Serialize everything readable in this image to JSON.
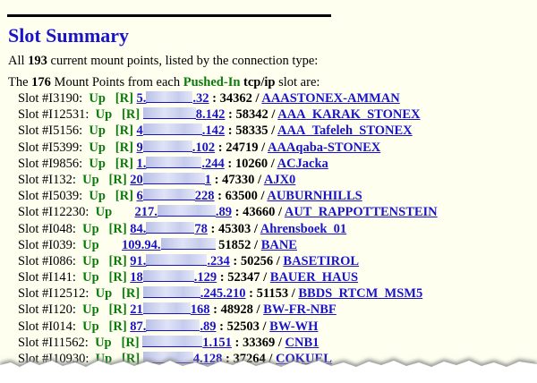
{
  "page": {
    "title": "Slot Summary",
    "intro": {
      "prefix": "All ",
      "count": "193",
      "suffix": " current mount points, listed by the connection type:"
    },
    "section": {
      "prefix": "The ",
      "count": "176",
      "middle": " Mount Points from each ",
      "type": "Pushed-In",
      "proto": " tcp/ip",
      "suffix": " slot are:"
    }
  },
  "slots": [
    {
      "slot": "Slot #I3190:",
      "status": "Up",
      "reg": "[R]",
      "ip_start": "5.",
      "ip_end": ".32",
      "port": " : 34362 / ",
      "mount": "AAASTONEX-AMMAN"
    },
    {
      "slot": "Slot #I12531:",
      "status": "Up",
      "reg": "[R]",
      "ip_start": "",
      "ip_end": "8.142",
      "port": " : 58342 / ",
      "mount": "AAA_KARAK_STONEX"
    },
    {
      "slot": "Slot #I5156:",
      "status": "Up",
      "reg": "[R]",
      "ip_start": "4",
      "ip_end": ".142",
      "port": " : 58335 / ",
      "mount": "AAA_Tafeleh_STONEX"
    },
    {
      "slot": "Slot #I5399:",
      "status": "Up",
      "reg": "[R]",
      "ip_start": "9",
      "ip_end": ".102",
      "port": " : 24719 / ",
      "mount": "AAAqaba-STONEX"
    },
    {
      "slot": "Slot #I9856:",
      "status": "Up",
      "reg": "[R]",
      "ip_start": "1.",
      "ip_end": ".244",
      "port": " : 10260 / ",
      "mount": "ACJacka"
    },
    {
      "slot": "Slot #I132:",
      "status": "Up",
      "reg": "[R]",
      "ip_start": "20",
      "ip_end": "1",
      "port": " : 47330 / ",
      "mount": "AJX0"
    },
    {
      "slot": "Slot #I5039:",
      "status": "Up",
      "reg": "[R]",
      "ip_start": "6",
      "ip_end": "228",
      "port": " : 63500 / ",
      "mount": "AUBURNHILLS"
    },
    {
      "slot": "Slot #I12230:",
      "status": "Up",
      "reg": "",
      "ip_start": "217.",
      "ip_end": ".89",
      "port": " : 43660 / ",
      "mount": "AUT_RAPPOTTENSTEIN"
    },
    {
      "slot": "Slot #I048:",
      "status": "Up",
      "reg": "[R]",
      "ip_start": "84.",
      "ip_end": "78",
      "port": " : 45303 / ",
      "mount": "Ahrensboek_01"
    },
    {
      "slot": "Slot #I039:",
      "status": "Up",
      "reg": "",
      "ip_start": "109.94.",
      "ip_end": "",
      "port": " 51852 / ",
      "mount": "BANE"
    },
    {
      "slot": "Slot #I086:",
      "status": "Up",
      "reg": "[R]",
      "ip_start": "91.",
      "ip_end": ".234",
      "port": " : 50256 / ",
      "mount": "BASETIROL"
    },
    {
      "slot": "Slot #I141:",
      "status": "Up",
      "reg": "[R]",
      "ip_start": "18",
      "ip_end": ".129",
      "port": " : 52347 / ",
      "mount": "BAUER_HAUS"
    },
    {
      "slot": "Slot #I12512:",
      "status": "Up",
      "reg": "[R]",
      "ip_start": "",
      "ip_end": ".245.210",
      "port": " : 51153 / ",
      "mount": "BBDS_RTCM_MSM5"
    },
    {
      "slot": "Slot #I120:",
      "status": "Up",
      "reg": "[R]",
      "ip_start": "21",
      "ip_end": "168",
      "port": " : 48928 / ",
      "mount": "BW-FR-NBF"
    },
    {
      "slot": "Slot #I014:",
      "status": "Up",
      "reg": "[R]",
      "ip_start": "87.",
      "ip_end": ".89",
      "port": " : 52503 / ",
      "mount": "BW-WH"
    },
    {
      "slot": "Slot #I11562:",
      "status": "Up",
      "reg": "[R]",
      "ip_start": "",
      "ip_end": "1.151",
      "port": " : 33369 / ",
      "mount": "CNB1"
    },
    {
      "slot": "Slot #I10930:",
      "status": "Up",
      "reg": "[R]",
      "ip_start": "",
      "ip_end": "4.128",
      "port": " : 37264 / ",
      "mount": "COKUEL"
    }
  ],
  "colors": {
    "background": "#fffff0",
    "heading": "#1a14c8",
    "link": "#1a14c8",
    "status": "#0a7a0a"
  }
}
